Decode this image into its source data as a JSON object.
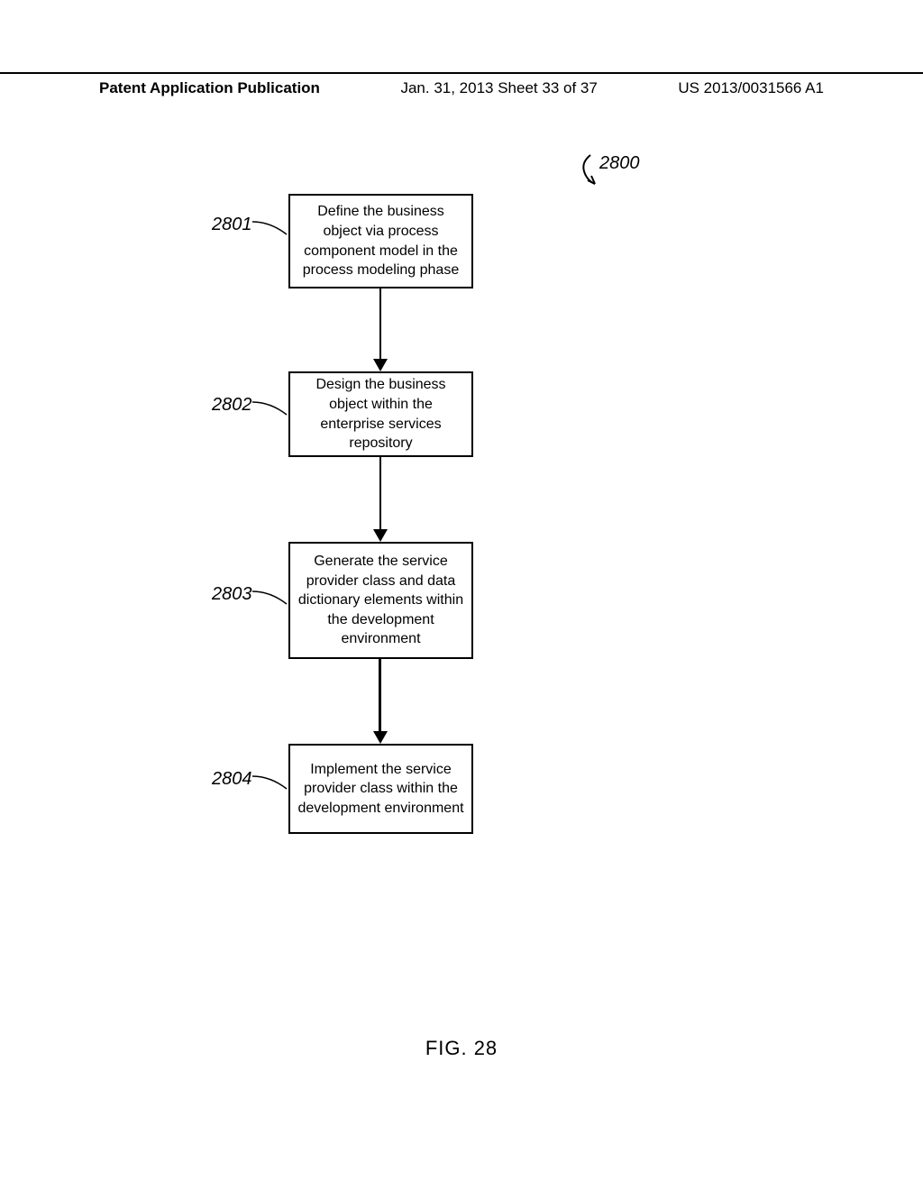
{
  "header": {
    "left": "Patent Application Publication",
    "mid": "Jan. 31, 2013  Sheet 33 of 37",
    "right": "US 2013/0031566 A1"
  },
  "diagram": {
    "main_ref": "2800",
    "steps": [
      {
        "ref": "2801",
        "text": "Define the business object via process component model in the process modeling phase"
      },
      {
        "ref": "2802",
        "text": "Design the business object within the enterprise services repository"
      },
      {
        "ref": "2803",
        "text": "Generate the service provider class and data dictionary elements within the development environment"
      },
      {
        "ref": "2804",
        "text": "Implement the service provider class within the development environment"
      }
    ]
  },
  "figure_caption": "FIG. 28"
}
